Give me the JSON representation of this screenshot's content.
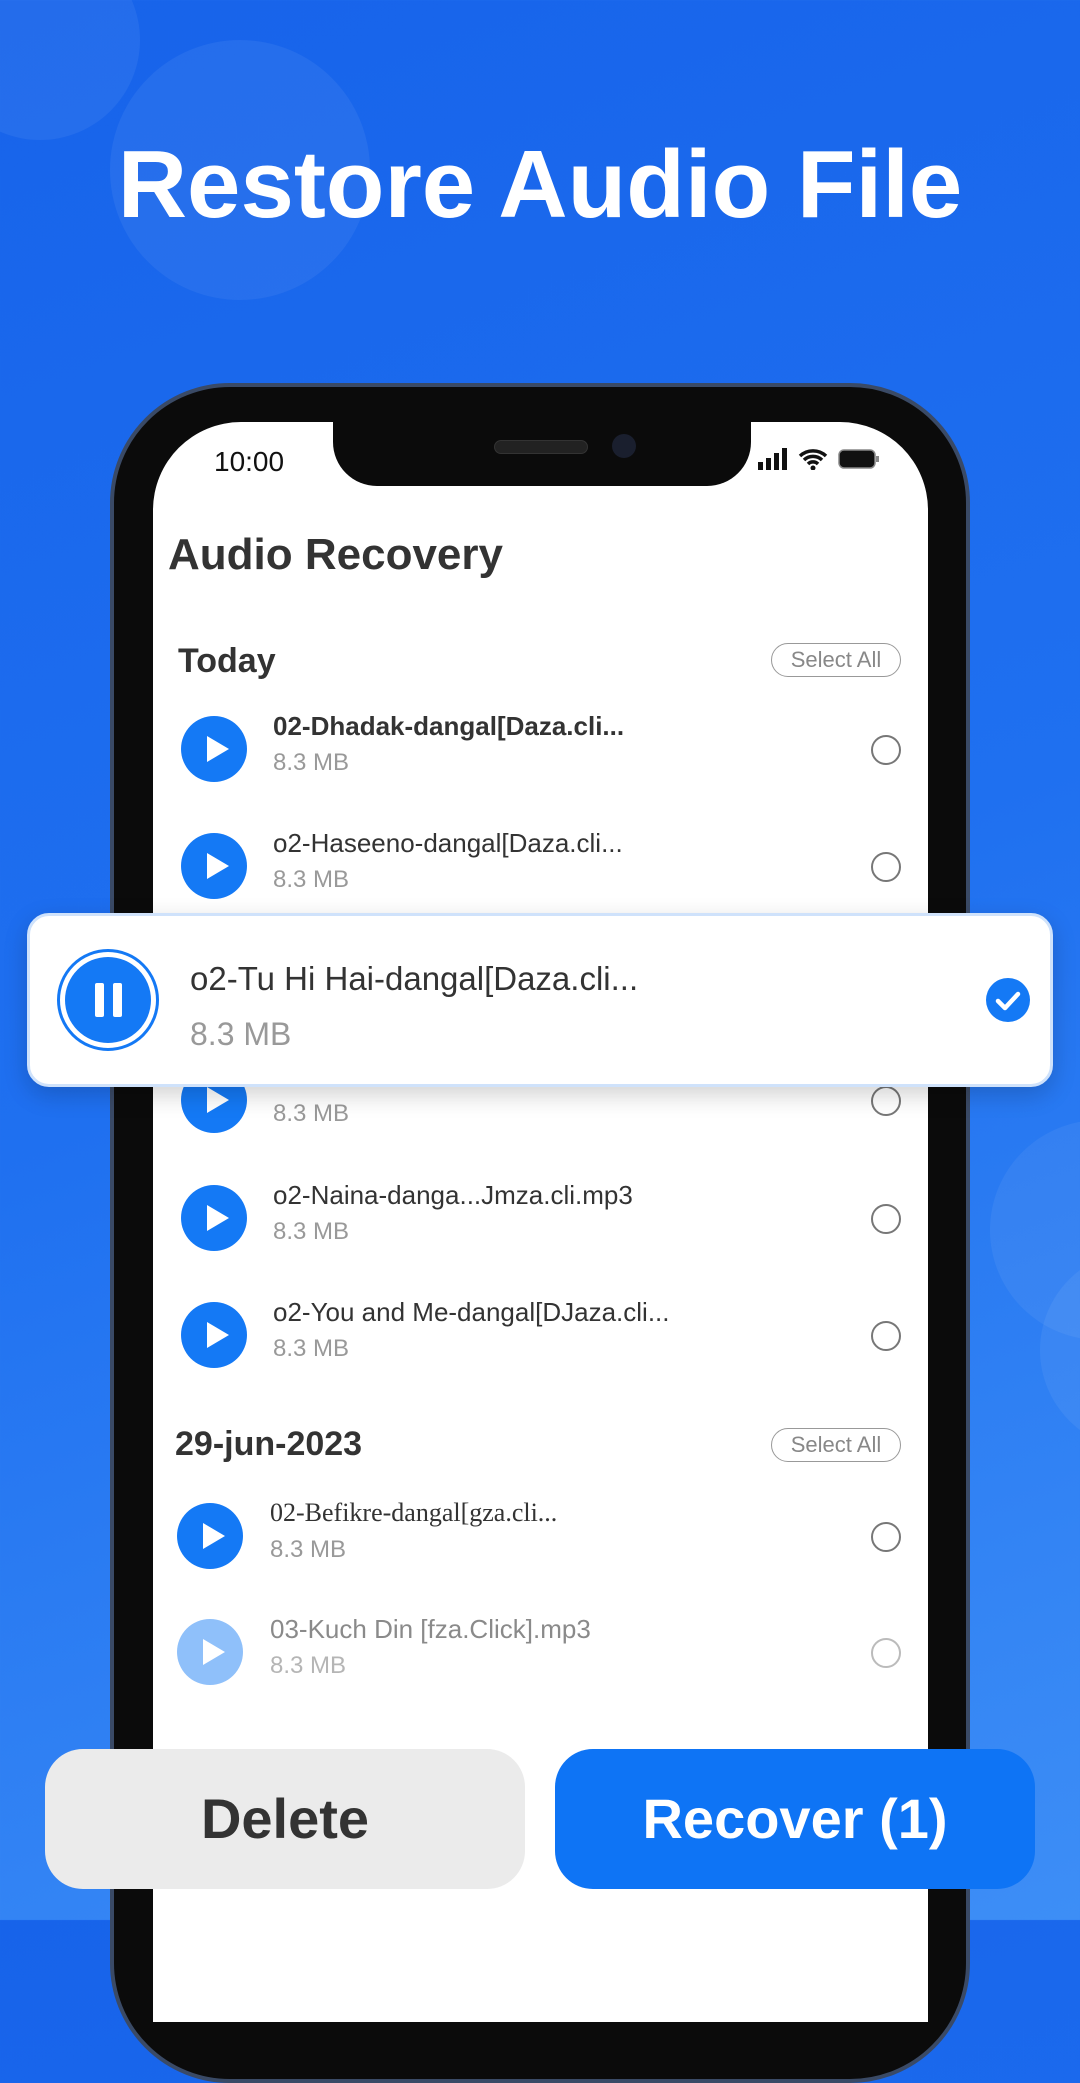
{
  "headline": "Restore Audio File",
  "status_bar": {
    "time": "10:00",
    "icons": [
      "signal-icon",
      "wifi-icon",
      "battery-icon"
    ]
  },
  "app_title": "Audio Recovery",
  "sections": [
    {
      "label": "Today",
      "select_all": "Select All"
    },
    {
      "label": "29-jun-2023",
      "select_all": "Select All"
    }
  ],
  "today_items": [
    {
      "name": "02-Dhadak-dangal[Daza.cli...",
      "size": "8.3 MB",
      "selected": false
    },
    {
      "name": "o2-Haseeno-dangal[Daza.cli...",
      "size": "8.3 MB",
      "selected": false
    },
    {
      "name": "",
      "size": "8.3 MB",
      "selected": false
    },
    {
      "name": "o2-Naina-danga...Jmza.cli.mp3",
      "size": "8.3 MB",
      "selected": false
    },
    {
      "name": "o2-You and Me-dangal[DJaza.cli...",
      "size": "8.3 MB",
      "selected": false
    }
  ],
  "older_items": [
    {
      "name": "02-Befikre-dangal[gza.cli...",
      "size": "8.3 MB",
      "selected": false
    },
    {
      "name": "03-Kuch Din [fza.Click].mp3",
      "size": "8.3 MB",
      "selected": false
    }
  ],
  "playing_card": {
    "name": "o2-Tu Hi Hai-dangal[Daza.cli...",
    "size": "8.3 MB",
    "selected": true,
    "state": "playing"
  },
  "buttons": {
    "delete": "Delete",
    "recover": "Recover (1)"
  },
  "colors": {
    "accent": "#1479f5",
    "background": "#1f70f0"
  }
}
